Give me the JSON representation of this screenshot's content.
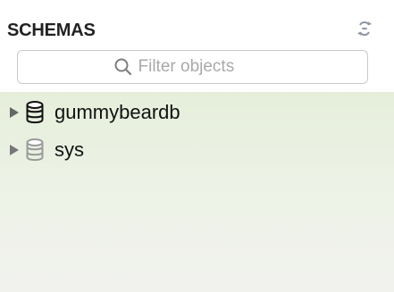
{
  "panel": {
    "title": "SCHEMAS",
    "refresh_icon": "refresh-icon"
  },
  "search": {
    "placeholder": "Filter objects",
    "value": ""
  },
  "schemas": [
    {
      "name": "gummybeardb",
      "icon": "database-icon",
      "expanded": false,
      "selected": false
    },
    {
      "name": "sys",
      "icon": "database-icon",
      "expanded": false,
      "selected": false
    }
  ],
  "colors": {
    "tree_background": "#e6eedb",
    "title": "#222222",
    "placeholder": "#a9a9a9"
  }
}
